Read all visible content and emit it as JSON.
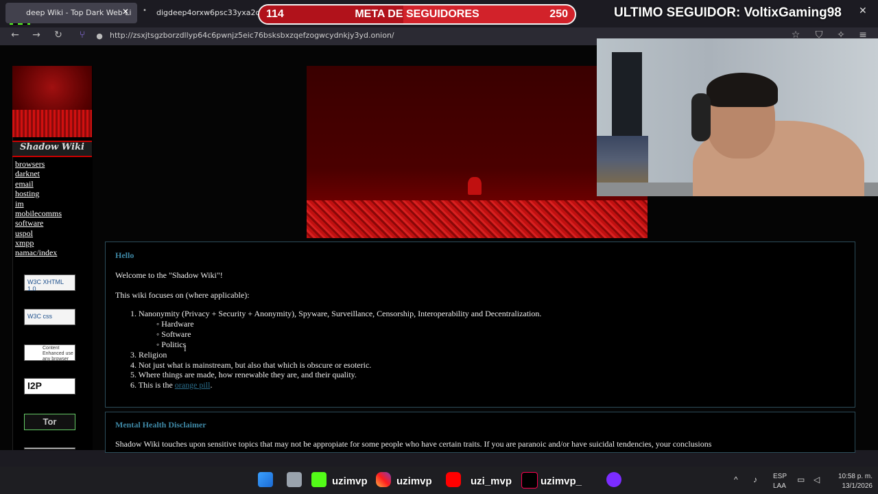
{
  "browser": {
    "tabs": [
      {
        "label": "deep Wiki - Top Dark Web Li"
      },
      {
        "label": "digdeep4orxw6psc33yxa2dgmu"
      }
    ],
    "url": "http://zsxjtsgzborzdllyp64c6pwnjz5eic76bsksbxzqefzogwcydnkjy3yd.onion/"
  },
  "overlay": {
    "kick_logo_text": "9",
    "goal": {
      "current": "114",
      "title": "META DE SEGUIDORES",
      "target": "250",
      "progress_fraction": 0.456
    },
    "last_follower": "ULTIMO SEGUIDOR: VoltixGaming98"
  },
  "sidebar": {
    "title": "Shadow Wiki",
    "links": [
      "browsers",
      "darknet",
      "email",
      "hosting",
      "im",
      "mobilecomms",
      "software",
      "uspol",
      "xmpp",
      "namac/index"
    ],
    "badges": {
      "xhtml": "W3C XHTML 1.0",
      "css": "W3C css",
      "content": "Content Enhanced use any browser",
      "i2p": "I2P",
      "tor": "Tor"
    }
  },
  "main": {
    "hello_heading": "Hello",
    "welcome": "Welcome to the \"Shadow Wiki\"!",
    "focus": "This wiki focuses on (where applicable):",
    "list": [
      "1. Nanonymity (Privacy + Security + Anonymity), Spyware, Surveillance, Censorship, Interoperability and Decentralization.",
      "3. Religion",
      "4. Not just what is mainstream, but also that which is obscure or esoteric.",
      "5. Where things are made, how renewable they are, and their quality.",
      "6. This is the"
    ],
    "sublist": [
      "Hardware",
      "Software",
      "Politics"
    ],
    "orange_pill": "orange pill",
    "disclaimer_heading": "Mental Health Disclaimer",
    "disclaimer_text": "Shadow Wiki touches upon sensitive topics that may not be appropiate for some people who have certain traits. If you are paranoic and/or have suicidal tendencies, your conclusions"
  },
  "taskbar": {
    "labels": [
      "uzimvp",
      "uzimvp",
      "uzi_mvp",
      "uzimvp_"
    ],
    "lang1": "ESP",
    "lang2": "LAA",
    "time": "10:58 p. m.",
    "date": "13/1/2026"
  },
  "colors": {
    "accent_red": "#d2222a",
    "link_blue": "#2b6e8c",
    "heading_blue": "#3f8aa8"
  }
}
